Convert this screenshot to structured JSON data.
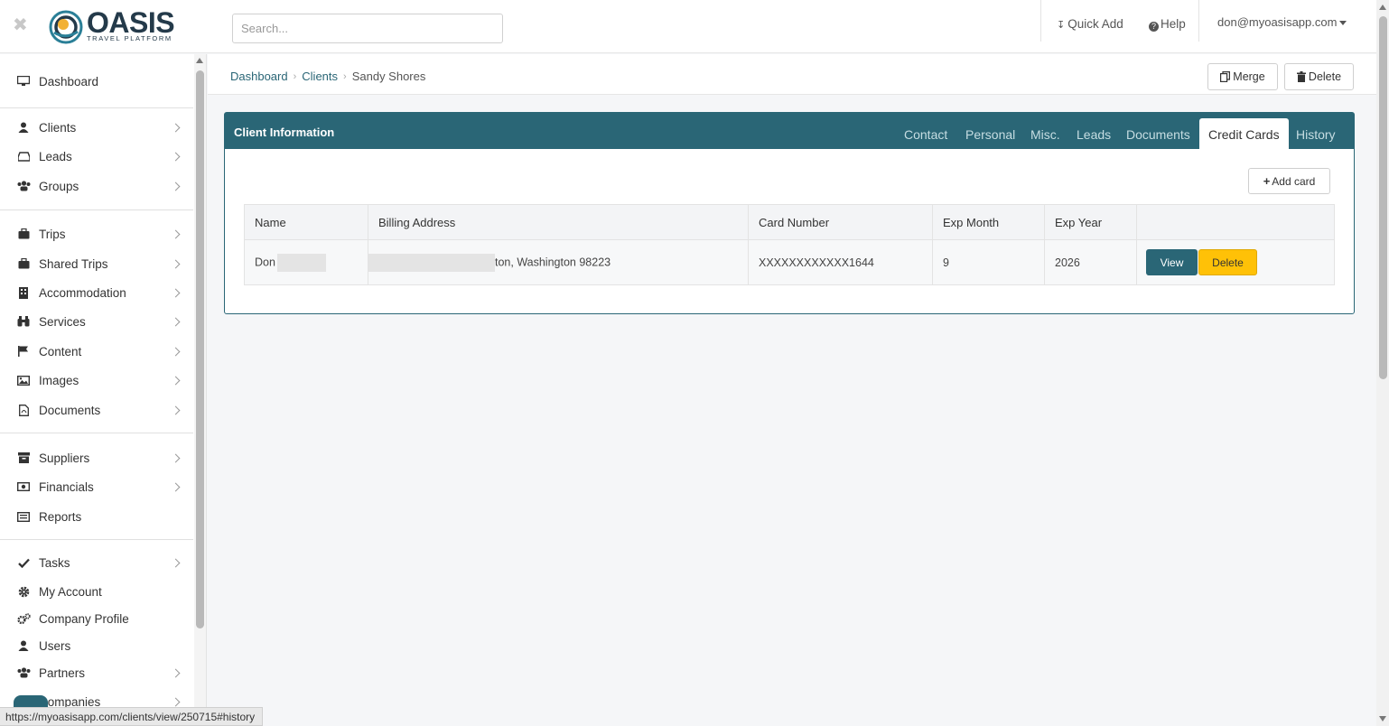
{
  "app": {
    "logo_word": "OASIS",
    "logo_sub": "TRAVEL PLATFORM",
    "close_glyph": "✖",
    "brand_color": "#2a6676",
    "warning_color": "#ffc107"
  },
  "header": {
    "search_placeholder": "Search...",
    "quick_add_icon": "↧",
    "quick_add_label": "Quick Add",
    "help_icon": "?",
    "help_label": "Help",
    "user_email": "don@myoasisapp.com"
  },
  "sidebar": {
    "items": [
      {
        "label": "Dashboard",
        "icon": "monitor-icon"
      },
      {
        "label": "Clients",
        "icon": "user-icon"
      },
      {
        "label": "Leads",
        "icon": "inbox-icon"
      },
      {
        "label": "Groups",
        "icon": "users-icon"
      },
      {
        "label": "Trips",
        "icon": "suitcase-icon"
      },
      {
        "label": "Shared Trips",
        "icon": "suitcase-icon"
      },
      {
        "label": "Accommodation",
        "icon": "building-icon"
      },
      {
        "label": "Services",
        "icon": "binoculars-icon"
      },
      {
        "label": "Content",
        "icon": "flag-icon"
      },
      {
        "label": "Images",
        "icon": "image-icon"
      },
      {
        "label": "Documents",
        "icon": "pdf-icon"
      },
      {
        "label": "Suppliers",
        "icon": "archive-icon"
      },
      {
        "label": "Financials",
        "icon": "money-icon"
      },
      {
        "label": "Reports",
        "icon": "list-icon"
      },
      {
        "label": "Tasks",
        "icon": "check-icon"
      },
      {
        "label": "My Account",
        "icon": "gear-icon"
      },
      {
        "label": "Company Profile",
        "icon": "gears-icon"
      },
      {
        "label": "Users",
        "icon": "user-icon"
      },
      {
        "label": "Partners",
        "icon": "users-icon"
      },
      {
        "label": "Companies",
        "icon": "building-icon"
      }
    ]
  },
  "breadcrumb": {
    "items": [
      "Dashboard",
      "Clients"
    ],
    "current": "Sandy Shores",
    "separator": "›"
  },
  "actions": {
    "merge_label": "Merge",
    "delete_label": "Delete"
  },
  "panel": {
    "title": "Client Information",
    "tabs": [
      "Contact",
      "Personal",
      "Misc.",
      "Leads",
      "Documents",
      "Credit Cards",
      "History"
    ],
    "active_tab": "Credit Cards",
    "add_card_label": "Add card"
  },
  "cards_table": {
    "columns": [
      "Name",
      "Billing Address",
      "Card Number",
      "Exp Month",
      "Exp Year",
      ""
    ],
    "rows": [
      {
        "name": "Don",
        "billing_address": "ton, Washington 98223",
        "card_number": "XXXXXXXXXXXX1644",
        "exp_month": "9",
        "exp_year": "2026",
        "view_label": "View",
        "delete_label": "Delete"
      }
    ]
  },
  "status_bar": {
    "url": "https://myoasisapp.com/clients/view/250715#history"
  }
}
